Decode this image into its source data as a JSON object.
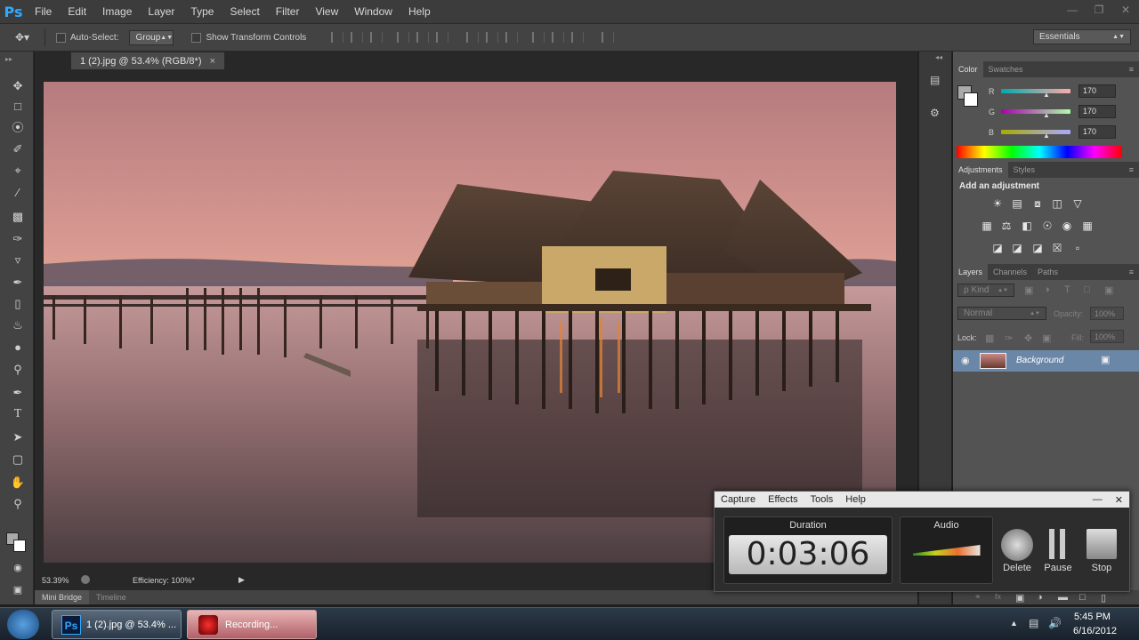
{
  "app": {
    "logo": "Ps"
  },
  "menu": [
    "File",
    "Edit",
    "Image",
    "Layer",
    "Type",
    "Select",
    "Filter",
    "View",
    "Window",
    "Help"
  ],
  "options": {
    "auto_select": "Auto-Select:",
    "group": "Group",
    "show_transform": "Show Transform Controls",
    "workspace": "Essentials"
  },
  "document": {
    "tab_title": "1 (2).jpg @ 53.4% (RGB/8*)",
    "close": "×"
  },
  "status": {
    "zoom": "53.39%",
    "efficiency": "Efficiency: 100%*"
  },
  "bottom_tabs": [
    "Mini Bridge",
    "Timeline"
  ],
  "color_panel": {
    "tabs": [
      "Color",
      "Swatches"
    ],
    "channels": [
      {
        "label": "R",
        "value": "170"
      },
      {
        "label": "G",
        "value": "170"
      },
      {
        "label": "B",
        "value": "170"
      }
    ]
  },
  "adjustments_panel": {
    "tabs": [
      "Adjustments",
      "Styles"
    ],
    "heading": "Add an adjustment"
  },
  "layers_panel": {
    "tabs": [
      "Layers",
      "Channels",
      "Paths"
    ],
    "kind": "ρ Kind",
    "blend_mode": "Normal",
    "opacity_label": "Opacity:",
    "opacity_value": "100%",
    "lock_label": "Lock:",
    "fill_label": "Fill:",
    "fill_value": "100%",
    "layer_name": "Background"
  },
  "recorder": {
    "menu": [
      "Capture",
      "Effects",
      "Tools",
      "Help"
    ],
    "duration_label": "Duration",
    "duration_value": "0:03:06",
    "audio_label": "Audio",
    "delete_label": "Delete",
    "pause_label": "Pause",
    "stop_label": "Stop"
  },
  "taskbar": {
    "ps_task": "1 (2).jpg @ 53.4% ...",
    "ps_icon": "Ps",
    "recording_task": "Recording...",
    "time": "5:45 PM",
    "date": "6/16/2012"
  },
  "colors": {
    "accent": "#31a8ff",
    "panel": "#535353",
    "dark": "#3c3c3c"
  }
}
